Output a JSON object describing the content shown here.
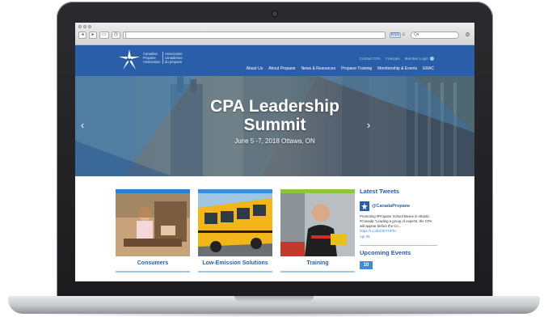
{
  "browser": {
    "back_label": "◂",
    "forward_label": "▸",
    "tabs_label": "▭",
    "history_label": "◷",
    "add_label": "+",
    "rss_label": "RSS",
    "reload_label": "c",
    "search_placeholder": "Q▾",
    "gear_label": "⚙"
  },
  "site": {
    "logo_en": "Canadian Propane Association",
    "logo_fr": "Association canadienne du propane",
    "top_links": [
      "Contact CPA",
      "Français",
      "Member Login"
    ],
    "nav": [
      "About Us",
      "About Propane",
      "News & Resources",
      "Propane Training",
      "Membership & Events",
      "ERAC"
    ]
  },
  "hero": {
    "title_line1": "CPA Leadership",
    "title_line2": "Summit",
    "subtitle": "June 5 -7, 2018 Ottawa, ON",
    "prev_label": "‹",
    "next_label": "›"
  },
  "cards": [
    {
      "label": "Consumers",
      "top_color": "#2a7fd0"
    },
    {
      "label": "Low-Emission Solutions",
      "top_color": "#3a8dd6"
    },
    {
      "label": "Training",
      "top_color": "#8cc63f"
    }
  ],
  "tweets": {
    "heading": "Latest Tweets",
    "handle": "@CanadaPropane",
    "text": "Promoting #Propane School Buses in Atlantic #Canada \"Leading a group of experts, the CPA will appear before the Co...",
    "link": "https://t.co/bzOEYHPfcr",
    "date": "Apr 05"
  },
  "events": {
    "heading": "Upcoming Events",
    "day": "10"
  },
  "colors": {
    "brand_blue": "#2a5ea8",
    "accent_light_blue": "#3a8dd6",
    "training_green": "#8cc63f"
  }
}
